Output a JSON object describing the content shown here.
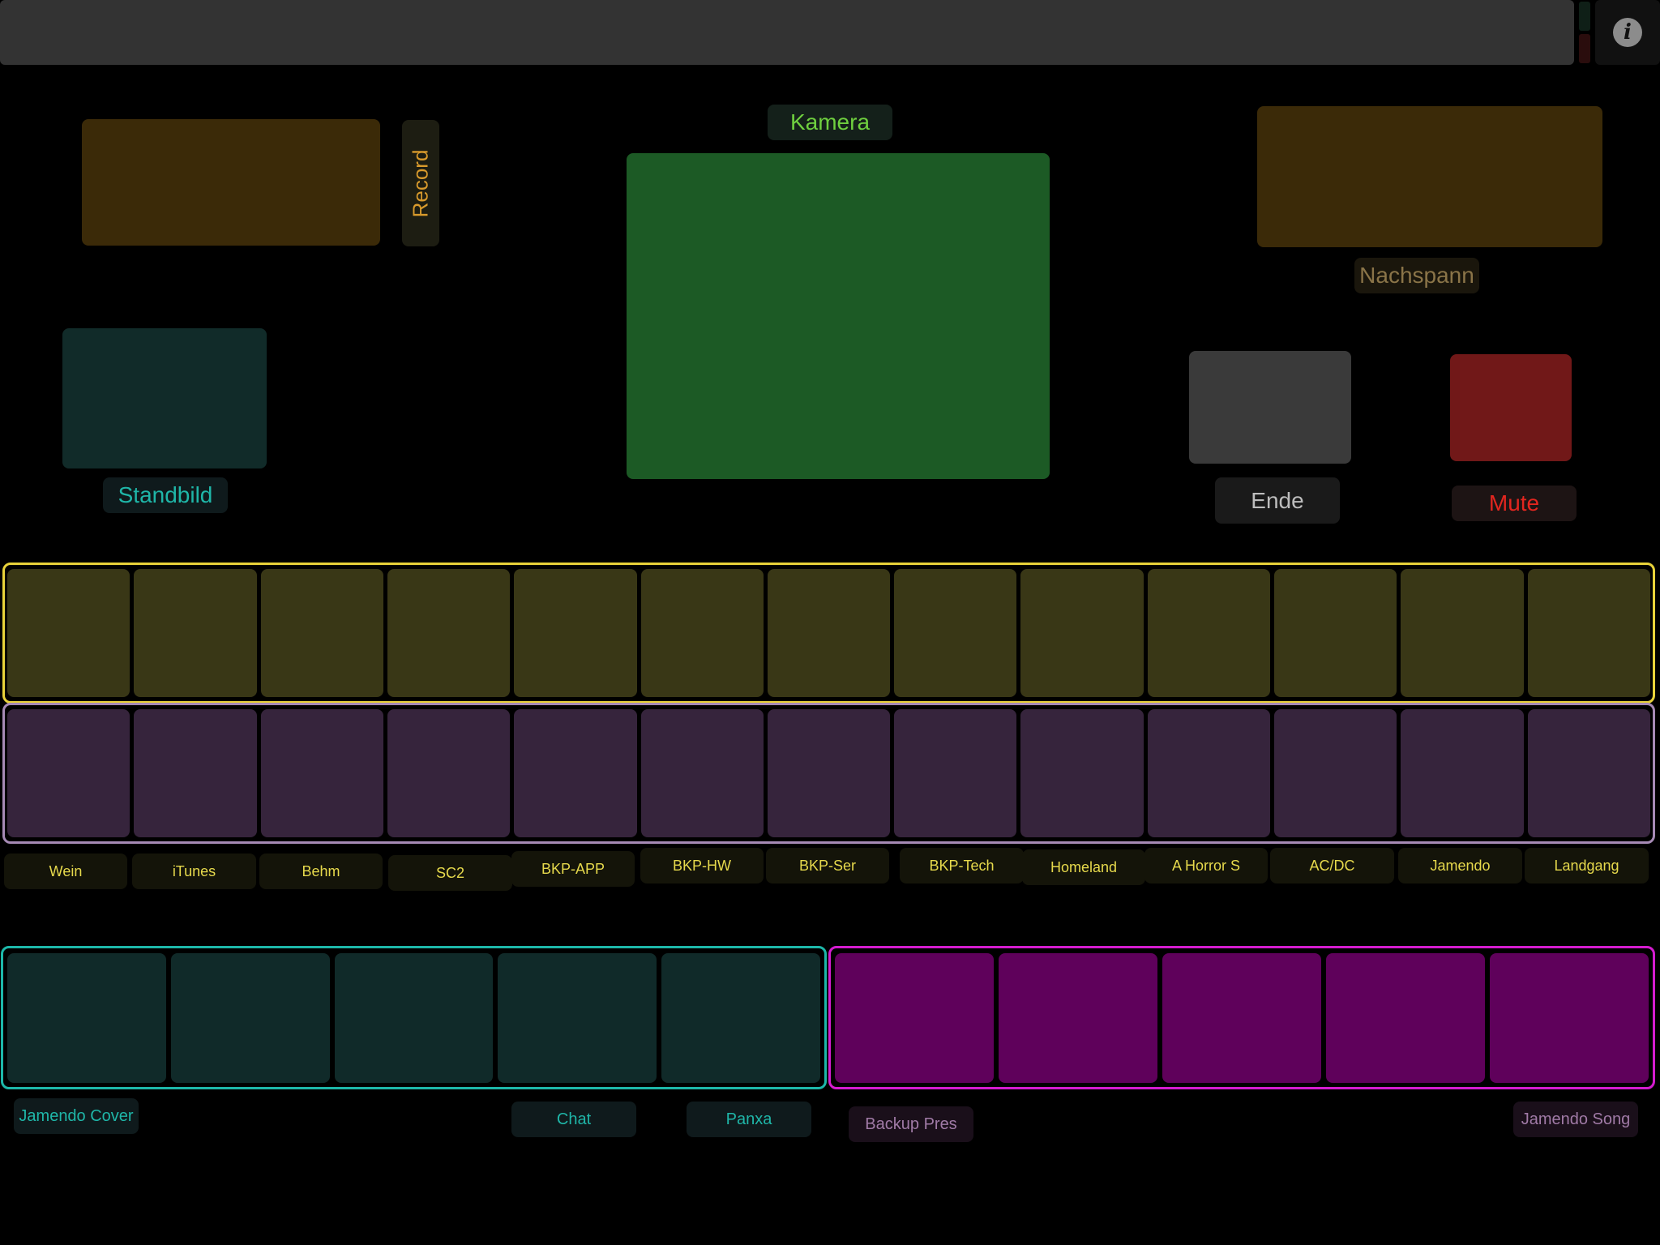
{
  "colors": {
    "background": "#000000",
    "topbar": "#333333",
    "kamera_pad": "#1c5a25",
    "record_pad": "#3b2a08",
    "standbild_pad": "#112b29",
    "ende_pad": "#3a3a3a",
    "mute_pad": "#711818",
    "yellow_strip_border": "#e8d23a",
    "yellow_pad": "#393716",
    "purple_strip_border": "#a68ab5",
    "purple_pad": "#36243c",
    "teal_strip_border": "#1db7a9",
    "teal_pad": "#102a29",
    "magenta_strip_border": "#d41ccf",
    "magenta_pad": "#5f015b"
  },
  "header": {
    "info_icon": "info-icon",
    "info_glyph": "i"
  },
  "top_controls": {
    "kamera_label": "Kamera",
    "record_label": "Record",
    "standbild_label": "Standbild",
    "nachspann_label": "Nachspann",
    "ende_label": "Ende",
    "mute_label": "Mute"
  },
  "channel_labels": [
    "Wein",
    "iTunes",
    "Behm",
    "SC2",
    "BKP-APP",
    "BKP-HW",
    "BKP-Ser",
    "BKP-Tech",
    "Homeland",
    "A Horror S",
    "AC/DC",
    "Jamendo",
    "Landgang"
  ],
  "bottom_labels": {
    "jamendo_cover": "Jamendo Cover",
    "chat": "Chat",
    "panxa": "Panxa",
    "backup_pres": "Backup Pres",
    "jamendo_song": "Jamendo Song"
  }
}
